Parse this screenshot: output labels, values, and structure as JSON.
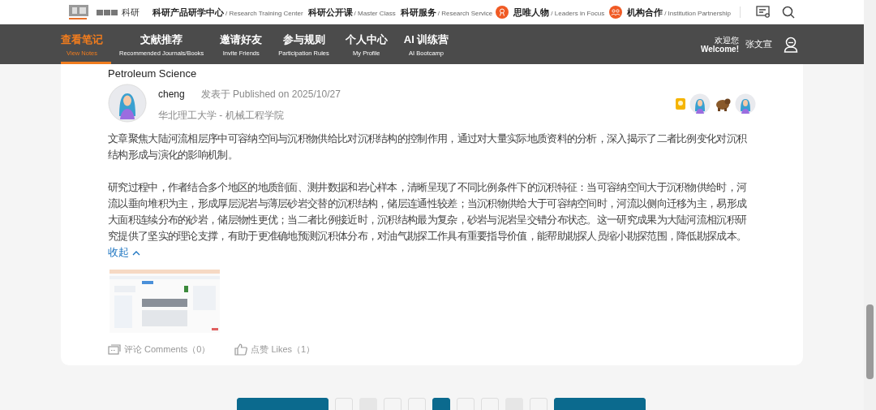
{
  "header": {
    "logo_text": "科研",
    "links": [
      {
        "title": "科研产品研学中心",
        "subtitle": "/ Research Training Center"
      },
      {
        "title": "科研公开课",
        "subtitle": "/ Master Class"
      },
      {
        "title": "科研服务",
        "subtitle": "/ Research Service"
      }
    ],
    "featured_links": [
      {
        "title": "思唯人物",
        "subtitle": "/ Leaders in Focus"
      },
      {
        "title": "机构合作",
        "subtitle": "/ Institution Partnership"
      }
    ]
  },
  "nav": {
    "items": [
      {
        "title": "查看笔记",
        "subtitle": "View Notes",
        "selected": true
      },
      {
        "title": "文献推荐",
        "subtitle": "Recommended Journals/Books",
        "selected": false
      },
      {
        "title": "邀请好友",
        "subtitle": "Invite Friends",
        "selected": false
      },
      {
        "title": "参与规则",
        "subtitle": "Participation Rules",
        "selected": false
      },
      {
        "title": "个人中心",
        "subtitle": "My Profile",
        "selected": false
      },
      {
        "title": "AI 训练营",
        "subtitle": "AI Bootcamp",
        "selected": false
      }
    ],
    "welcome": "欢迎您",
    "welcome_en": "Welcome!",
    "user_name": "张文宣"
  },
  "note": {
    "journal": "Petroleum Science",
    "author": "cheng",
    "published": "发表于 Published on 2025/10/27",
    "affiliation": "华北理工大学 - 机械工程学院",
    "paragraphs": [
      "文章聚焦大陆河流相层序中可容纳空间与沉积物供给比对沉积结构的控制作用，通过对大量实际地质资料的分析，深入揭示了二者比例变化对沉积结构形成与演化的影响机制。",
      "研究过程中，作者结合多个地区的地质剖面、测井数据和岩心样本，清晰呈现了不同比例条件下的沉积特征：当可容纳空间大于沉积物供给时，河流以垂向堆积为主，形成厚层泥岩与薄层砂岩交替的沉积结构，储层连通性较差；当沉积物供给大于可容纳空间时，河流以侧向迁移为主，易形成大面积连续分布的砂岩，储层物性更优；当二者比例接近时，沉积结构最为复杂，砂岩与泥岩呈交错分布状态。这一研究成果为大陆河流相沉积研究提供了坚实的理论支撑，有助于更准确地预测沉积体分布，对油气勘探工作具有重要指导价值，能帮助勘探人员缩小勘探范围，降低勘探成本。"
    ],
    "collapse": "收起",
    "attachment": {
      "kind": "picture"
    },
    "comments": "评论 Comments（0）",
    "likes": "点赞 Likes（1）"
  },
  "pagination": {
    "pages": [
      {
        "kind": "prev"
      },
      {
        "kind": "page",
        "selected": false
      },
      {
        "kind": "gap"
      },
      {
        "kind": "page",
        "selected": false
      },
      {
        "kind": "page",
        "selected": false
      },
      {
        "kind": "page",
        "selected": true
      },
      {
        "kind": "page",
        "selected": false
      },
      {
        "kind": "page",
        "selected": false
      },
      {
        "kind": "gap"
      },
      {
        "kind": "page",
        "selected": false
      },
      {
        "kind": "next"
      }
    ]
  }
}
